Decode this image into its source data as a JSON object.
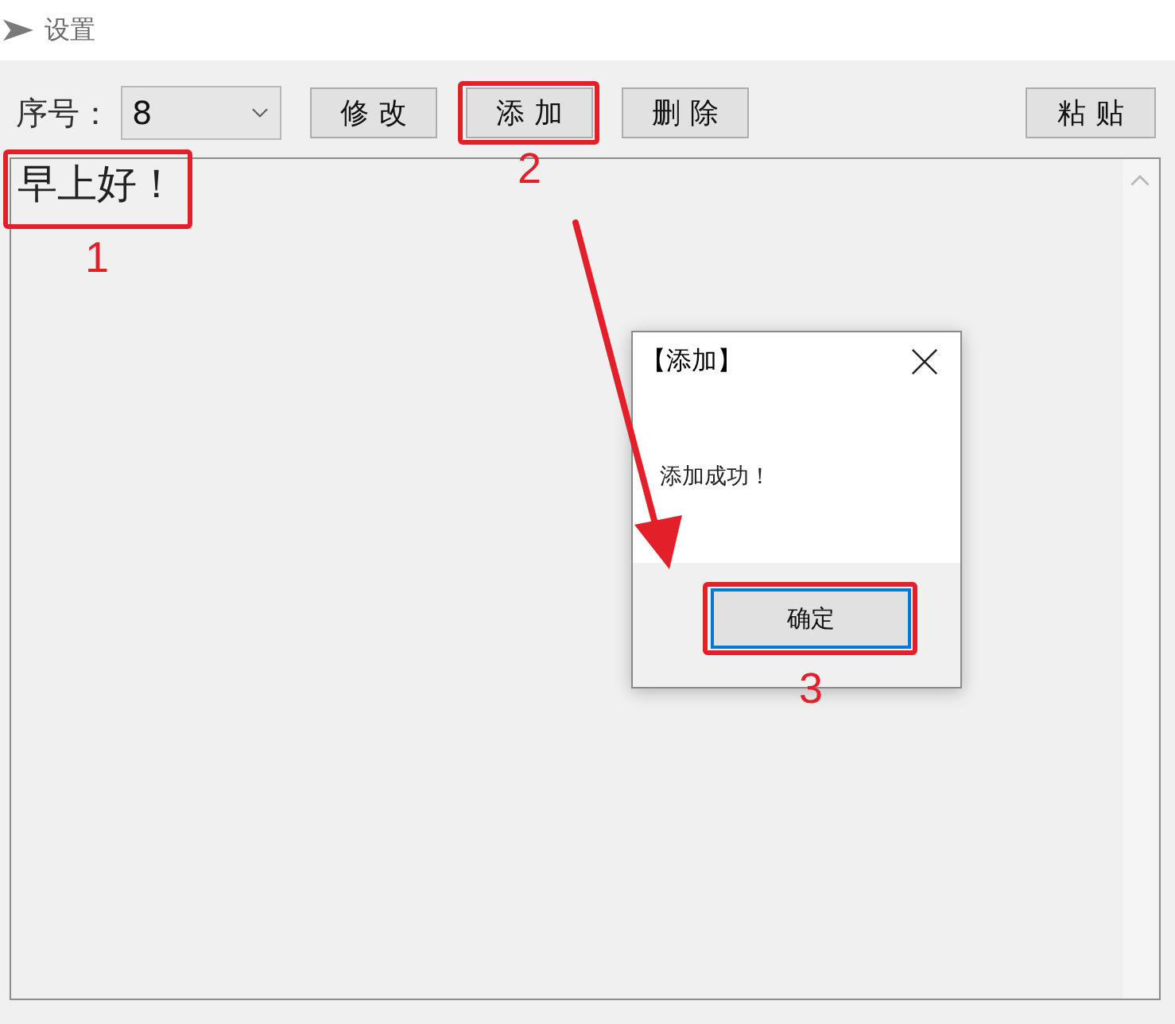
{
  "window": {
    "title": "设置"
  },
  "toolbar": {
    "index_label": "序号：",
    "index_value": "8",
    "buttons": [
      {
        "label": "修 改"
      },
      {
        "label": "添 加",
        "callout": "2"
      },
      {
        "label": "删 除"
      }
    ],
    "end_buttons": [
      {
        "label": "粘 贴"
      }
    ]
  },
  "text_area": {
    "text": "早上好！",
    "callout": "1"
  },
  "dialog": {
    "title": "【添加】",
    "message": "添加成功！",
    "button": {
      "label": "确定",
      "focused": true,
      "callout": "3"
    }
  },
  "annotation_arrow": true
}
